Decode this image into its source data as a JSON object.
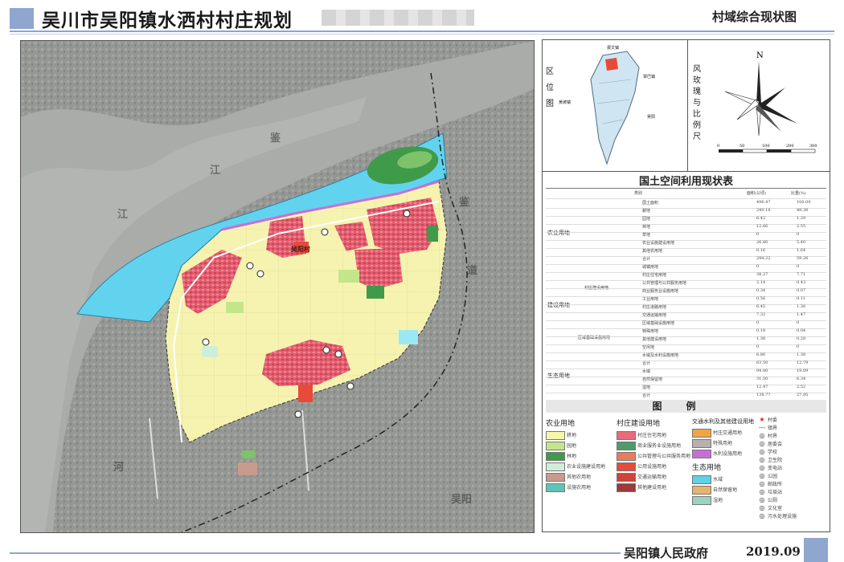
{
  "header": {
    "title": "吴川市吴阳镇水洒村村庄规划",
    "subtitle": "村域综合现状图"
  },
  "footer": {
    "org": "吴阳镇人民政府",
    "date": "2019.09"
  },
  "map": {
    "labels": [
      "鉴",
      "江",
      "江",
      "鉴",
      "道",
      "河",
      "吴阳村",
      "吴阳"
    ]
  },
  "location": {
    "label": "区位图",
    "places": [
      "振文镇",
      "覃巴镇",
      "黄坡镇",
      "吴阳"
    ]
  },
  "north": {
    "label": "风玫瑰与比例尺",
    "letter": "N",
    "scale_ticks": [
      "0",
      "50",
      "100",
      "200",
      "300"
    ]
  },
  "table": {
    "title": "国土空间利用现状表",
    "headers": [
      "类别",
      "面积(公顷)",
      "比重(%)"
    ],
    "groups": [
      "农业用地",
      "建设用地",
      "村庄建设用地",
      "区域基础设施用地",
      "生态用地"
    ],
    "rows": [
      [
        "国土面积",
        "496.47",
        "100.00"
      ],
      [
        "耕地",
        "240.18",
        "48.38"
      ],
      [
        "园地",
        "6.42",
        "1.29"
      ],
      [
        "林地",
        "12.66",
        "2.55"
      ],
      [
        "草地",
        "0",
        "0"
      ],
      [
        "农业设施建设用地",
        "26.80",
        "5.40"
      ],
      [
        "其他农用地",
        "8.16",
        "1.64"
      ],
      [
        "合计",
        "294.22",
        "59.26"
      ],
      [
        "城镇用地",
        "0",
        "0"
      ],
      [
        "村庄住宅用地",
        "38.27",
        "7.71"
      ],
      [
        "公共管理与公共服务用地",
        "2.14",
        "0.43"
      ],
      [
        "商业服务业设施用地",
        "0.34",
        "0.07"
      ],
      [
        "工业用地",
        "0.56",
        "0.11"
      ],
      [
        "村庄道路用地",
        "6.45",
        "1.30"
      ],
      [
        "交通运输用地",
        "7.32",
        "1.47"
      ],
      [
        "区域基础设施用地",
        "0",
        "0"
      ],
      [
        "特殊用地",
        "0.18",
        "0.04"
      ],
      [
        "其他建设用地",
        "1.38",
        "0.28"
      ],
      [
        "空闲地",
        "0",
        "0"
      ],
      [
        "水域及水利设施用地",
        "6.86",
        "1.38"
      ],
      [
        "合计",
        "63.50",
        "12.79"
      ],
      [
        "水域",
        "94.80",
        "19.09"
      ],
      [
        "自然保留地",
        "31.50",
        "6.34"
      ],
      [
        "湿地",
        "12.47",
        "2.52"
      ],
      [
        "合计",
        "138.77",
        "27.95"
      ]
    ]
  },
  "legend": {
    "title": "图例",
    "col1": {
      "head": "农业用地",
      "items": [
        {
          "label": "耕地",
          "color": "#f7f5a8"
        },
        {
          "label": "园地",
          "color": "#c3e68a"
        },
        {
          "label": "林地",
          "color": "#3f9a4a"
        },
        {
          "label": "农业设施建设用地",
          "color": "#cfeeda"
        },
        {
          "label": "其他农用地",
          "color": "#c79b8e"
        },
        {
          "label": "设施农用地",
          "color": "#5fc4b6"
        }
      ]
    },
    "col2": {
      "head": "村庄建设用地",
      "items": [
        {
          "label": "村庄住宅用地",
          "color": "#e96a7b"
        },
        {
          "label": "商业服务业设施用地",
          "color": "#4f9a6b"
        },
        {
          "label": "公共管理与公共服务用地",
          "color": "#ee7a5c"
        },
        {
          "label": "公用设施用地",
          "color": "#e84a3a"
        },
        {
          "label": "交通运输用地",
          "color": "#d0423a"
        },
        {
          "label": "其他建设用地",
          "color": "#9a3a3a"
        }
      ]
    },
    "col3": {
      "head": "交通水利及其他建设用地",
      "items": [
        {
          "label": "村庄交通用地",
          "color": "#f2a347"
        },
        {
          "label": "特殊用地",
          "color": "#b8b0b0"
        },
        {
          "label": "水利设施用地",
          "color": "#c86fd6"
        }
      ],
      "head2": "生态用地",
      "items2": [
        {
          "label": "水域",
          "color": "#5fd1e8"
        },
        {
          "label": "自然保留地",
          "color": "#e8b36a"
        },
        {
          "label": "湿地",
          "color": "#9bd3c0"
        }
      ]
    },
    "col4": {
      "items": [
        {
          "sym": "★",
          "label": "村委"
        },
        {
          "sym": "---",
          "label": "镇界"
        },
        {
          "sym": "◎",
          "label": "村界"
        },
        {
          "sym": "◎",
          "label": "居委会"
        },
        {
          "sym": "◎",
          "label": "学校"
        },
        {
          "sym": "◎",
          "label": "卫生院"
        },
        {
          "sym": "◎",
          "label": "变电站"
        },
        {
          "sym": "◎",
          "label": "公园"
        },
        {
          "sym": "◎",
          "label": "邮政所"
        },
        {
          "sym": "◎",
          "label": "垃圾站"
        },
        {
          "sym": "◎",
          "label": "公厕"
        },
        {
          "sym": "◎",
          "label": "文化室"
        },
        {
          "sym": "◎",
          "label": "污水处理设施"
        }
      ]
    }
  },
  "colors": {
    "water": "#62d3ef",
    "farmland": "#f6f3b0",
    "residential": "#e35d6f",
    "forest": "#3f9a4a",
    "boundary": "#c86fd6"
  }
}
